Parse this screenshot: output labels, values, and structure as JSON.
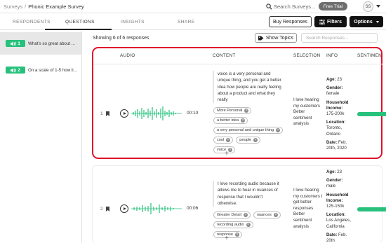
{
  "breadcrumb": {
    "root": "Surveys",
    "separator": "/",
    "current": "Phonic Example Survey"
  },
  "top_search": {
    "label": "Search Surveys..."
  },
  "trial_badge": "Free Trial",
  "user": {
    "initials": "SS"
  },
  "tabs": [
    {
      "label": "RESPONDENTS",
      "active": false
    },
    {
      "label": "QUESTIONS",
      "active": true
    },
    {
      "label": "INSIGHTS",
      "active": false
    },
    {
      "label": "SHARE",
      "active": false
    }
  ],
  "actions": {
    "buy_responses": "Buy Responses",
    "filters": "Filters",
    "options": "Options"
  },
  "sidebar": {
    "items": [
      {
        "number": "1",
        "text": "What's so great about ...",
        "active": true
      },
      {
        "number": "2",
        "text": "On a scale of 1-5 how li...",
        "active": false
      }
    ]
  },
  "main": {
    "count_text": "Showing 6 of 6 responses",
    "show_topics": "Show Topics",
    "search_placeholder": "Search Responses...",
    "columns": {
      "audio": "AUDIO",
      "content": "CONTENT",
      "selection": "SELECTION",
      "info": "INFO",
      "sentiment": "SENTIMEN"
    },
    "rows": [
      {
        "number": "1",
        "duration": "00:10",
        "transcript": "voice is a very personal and unique thing, and you get a better idea how people are really feeling about a product and what they really",
        "tags": [
          "More Personal",
          "a better idea",
          "a very personal and unique thing",
          "cool",
          "people",
          "voice"
        ],
        "add": "+",
        "selection": "I love hearing my customers Better sentiment analysis",
        "info": {
          "age_label": "Age:",
          "age": "23",
          "gender_label": "Gender:",
          "gender": "female",
          "income_label": "Household Income:",
          "income": "175-200k",
          "location_label": "Location:",
          "location": "Toronto, Ontario",
          "date_label": "Date:",
          "date": "Feb. 20th, 2020"
        }
      },
      {
        "number": "2",
        "duration": "00:06",
        "transcript": "I love recording audio because it allows me to hear in nuances of response that I wouldn't otherwise.",
        "tags": [
          "Greater Detail",
          "nuances",
          "recording audio",
          "response"
        ],
        "add": "+",
        "selection": "I love hearing my customers I get better responses Better sentiment analysis",
        "info": {
          "age_label": "Age:",
          "age": "23",
          "gender_label": "Gender:",
          "gender": "male",
          "income_label": "Household Income:",
          "income": "125-150k",
          "location_label": "Location:",
          "location": "Los Angeles, California",
          "date_label": "Date:",
          "date": "Feb. 20th"
        }
      }
    ]
  },
  "colors": {
    "accent_green": "#27c17c",
    "highlight_red": "#e0122a",
    "dark_button": "#111111"
  }
}
